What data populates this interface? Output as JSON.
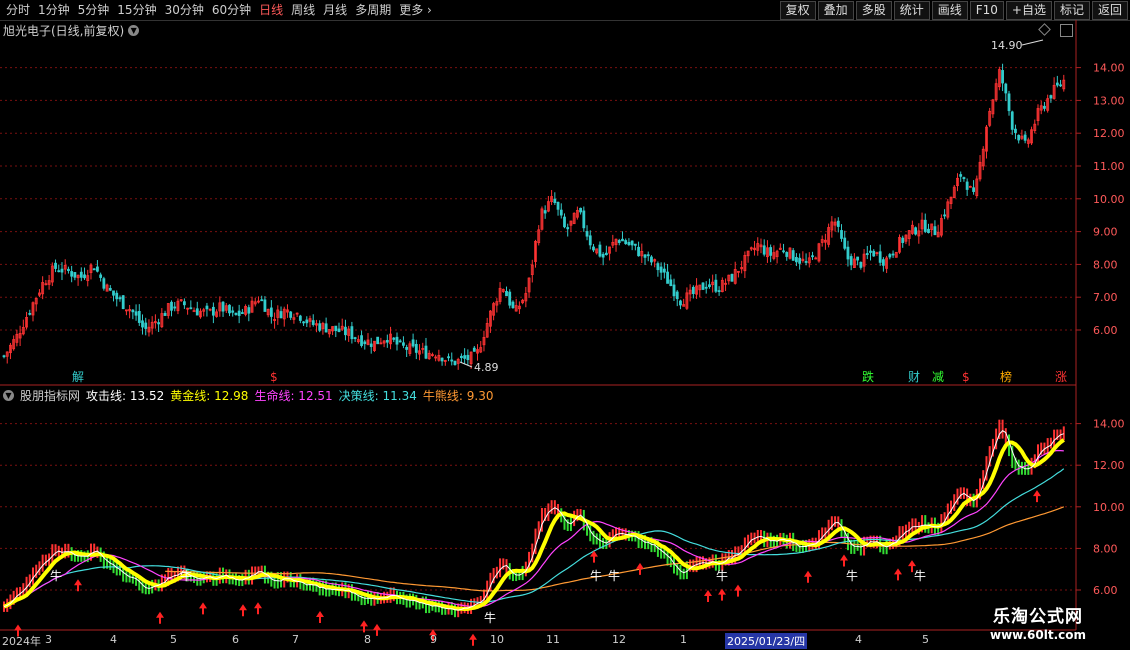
{
  "toolbar": {
    "tabs": [
      {
        "label": "分时",
        "active": false
      },
      {
        "label": "1分钟",
        "active": false
      },
      {
        "label": "5分钟",
        "active": false
      },
      {
        "label": "15分钟",
        "active": false
      },
      {
        "label": "30分钟",
        "active": false
      },
      {
        "label": "60分钟",
        "active": false
      },
      {
        "label": "日线",
        "active": true
      },
      {
        "label": "周线",
        "active": false
      },
      {
        "label": "月线",
        "active": false
      },
      {
        "label": "多周期",
        "active": false
      },
      {
        "label": "更多",
        "active": false
      }
    ],
    "right_buttons": [
      "复权",
      "叠加",
      "多股",
      "统计",
      "画线",
      "F10",
      "+自选",
      "标记",
      "返回"
    ]
  },
  "stock": {
    "title": "旭光电子(日线,前复权)"
  },
  "price_axis": {
    "ticks": [
      "14.00",
      "13.00",
      "12.00",
      "11.00",
      "10.00",
      "9.00",
      "8.00",
      "7.00",
      "6.00"
    ]
  },
  "indicator_axis": {
    "ticks": [
      "14.00",
      "12.00",
      "10.00",
      "8.00",
      "6.00"
    ]
  },
  "annotations": {
    "high_label": "14.90",
    "low_label": "4.89",
    "events": [
      "解",
      "$",
      "跌",
      "财",
      "减",
      "$",
      "榜",
      "涨"
    ]
  },
  "indicator": {
    "name": "股朋指标网",
    "lines": [
      {
        "label": "攻击线:",
        "value": "13.52",
        "color": "#ffffff"
      },
      {
        "label": "黄金线:",
        "value": "12.98",
        "color": "#ffff00"
      },
      {
        "label": "生命线:",
        "value": "12.51",
        "color": "#ff44ff"
      },
      {
        "label": "决策线:",
        "value": "11.34",
        "color": "#44dddd"
      },
      {
        "label": "牛熊线:",
        "value": "9.30",
        "color": "#ff9933"
      }
    ],
    "bull_label": "牛"
  },
  "dates": [
    "2024年",
    "3",
    "4",
    "5",
    "6",
    "7",
    "8",
    "9",
    "10",
    "11",
    "12",
    "1",
    "2025/01/23/四",
    "4",
    "5"
  ],
  "watermark": {
    "line1": "乐淘公式网",
    "line2": "www.60lt.com"
  },
  "colors": {
    "up": "#ff3333",
    "down": "#33cccc",
    "grid": "#7a1010",
    "axis": "#aa2222"
  },
  "chart_data": {
    "type": "candlestick",
    "title": "旭光电子(日线,前复权)",
    "closes": [
      5.2,
      5.8,
      6.6,
      7.4,
      7.9,
      7.8,
      7.6,
      8.0,
      7.3,
      6.9,
      6.6,
      6.0,
      6.3,
      6.7,
      6.8,
      6.6,
      6.5,
      6.7,
      6.4,
      6.6,
      7.0,
      6.4,
      6.6,
      6.5,
      6.2,
      6.1,
      6.0,
      5.9,
      5.7,
      5.6,
      5.8,
      5.5,
      5.4,
      5.3,
      5.3,
      5.0,
      5.1,
      5.2,
      6.4,
      7.4,
      6.5,
      7.2,
      9.5,
      10.0,
      9.0,
      9.6,
      8.6,
      8.2,
      8.8,
      8.6,
      8.3,
      8.0,
      7.5,
      6.9,
      7.1,
      7.4,
      7.3,
      7.6,
      8.1,
      8.6,
      8.3,
      8.5,
      8.2,
      8.0,
      8.6,
      9.4,
      8.2,
      8.0,
      8.4,
      8.1,
      8.6,
      9.0,
      9.2,
      9.0,
      9.9,
      10.8,
      10.0,
      12.4,
      13.9,
      12.2,
      11.6,
      12.6,
      13.2,
      13.6
    ],
    "high_point": 14.9,
    "low_point": 4.89,
    "ylim": [
      5.0,
      15.0
    ]
  }
}
